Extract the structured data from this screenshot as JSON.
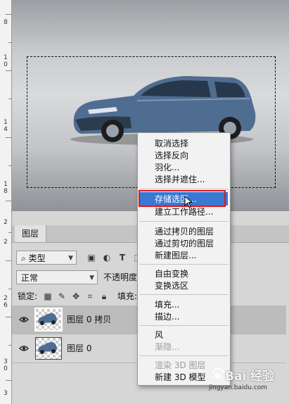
{
  "ruler": {
    "ticks": [
      "8",
      "1",
      "0",
      "1",
      "4",
      "1",
      "8",
      "2",
      "2",
      "2",
      "6",
      "3",
      "0",
      "3"
    ]
  },
  "layers_panel": {
    "tab_label": "图层",
    "kind_filter": {
      "value": "类型",
      "icon": "search-icon"
    },
    "blend_mode": {
      "value": "正常"
    },
    "opacity_label": "不透明度:",
    "lock_label": "锁定:",
    "fill_label": "填充:",
    "layers": [
      {
        "name": "图层 0 拷贝",
        "selected": true,
        "visible": true
      },
      {
        "name": "图层 0",
        "selected": false,
        "visible": true
      }
    ]
  },
  "context_menu": {
    "groups": [
      [
        "取消选择",
        "选择反向",
        "羽化...",
        "选择并遮住..."
      ],
      [
        "存储选区...",
        "建立工作路径..."
      ],
      [
        "通过拷贝的图层",
        "通过剪切的图层",
        "新建图层..."
      ],
      [
        "自由变换",
        "变换选区"
      ],
      [
        "填充...",
        "描边..."
      ],
      [
        "风",
        "渐隐..."
      ],
      [
        "渲染 3D 图层",
        "新建 3D 模型"
      ]
    ],
    "highlighted": "存储选区...",
    "disabled": [
      "渐隐...",
      "渲染 3D 图层"
    ],
    "highlight_color": "#3a78d4",
    "annotation_color": "#e01818"
  },
  "watermark": {
    "brand": "Bai 经验",
    "url": "jingyan.baidu.com"
  }
}
